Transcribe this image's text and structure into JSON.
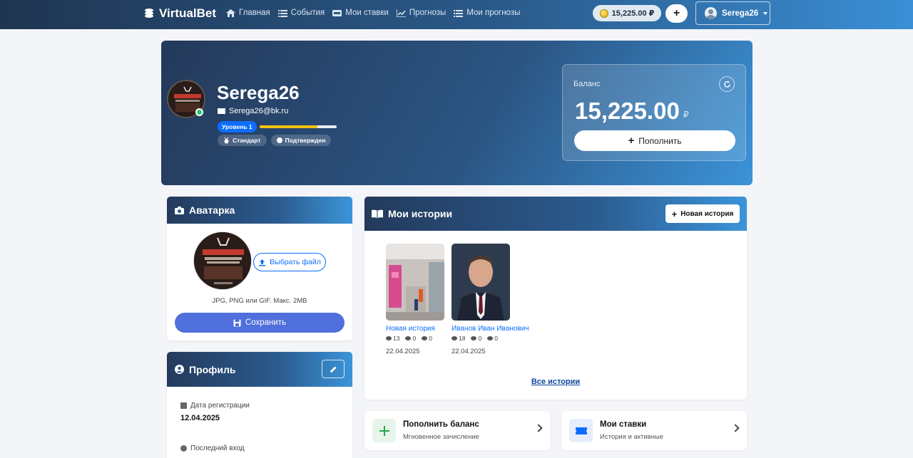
{
  "navbar": {
    "brand": "VirtualBet",
    "links": [
      {
        "label": "Главная",
        "icon": "home-icon"
      },
      {
        "label": "События",
        "icon": "list-icon"
      },
      {
        "label": "Мои ставки",
        "icon": "ticket-icon"
      },
      {
        "label": "Прогнозы",
        "icon": "chart-icon"
      },
      {
        "label": "Мои прогнозы",
        "icon": "list-icon"
      }
    ],
    "balance": "15,225.00 ₽",
    "plus": "+",
    "username": "Serega26"
  },
  "hero": {
    "name": "Serega26",
    "email": "Serega26@bk.ru",
    "level_label": "Уровень 1",
    "level_progress_percent": 75,
    "tags": [
      "Стандарт",
      "Подтвержден"
    ]
  },
  "balance_card": {
    "label": "Баланс",
    "amount": "15,225.00",
    "currency": "₽",
    "topup_label": "Пополнить"
  },
  "avatar_card": {
    "title": "Аватарка",
    "choose_label": "Выбрать файл",
    "hint": "JPG, PNG или GIF. Макс. 2MB",
    "save_label": "Сохранить"
  },
  "profile_card": {
    "title": "Профиль",
    "fields": [
      {
        "label": "Дата регистрации",
        "value": "12.04.2025"
      },
      {
        "label": "Последний вход",
        "value": ""
      }
    ]
  },
  "stories_card": {
    "title": "Мои истории",
    "new_story_label": "Новая история",
    "stories": [
      {
        "title": "Новая история",
        "views": "13",
        "likes": "0",
        "comments": "0",
        "date": "22.04.2025"
      },
      {
        "title": "Иванов Иван Иванович",
        "views": "18",
        "likes": "0",
        "comments": "0",
        "date": "22.04.2025"
      }
    ],
    "all_label": "Все истории"
  },
  "actions": [
    {
      "title": "Пополнить баланс",
      "subtitle": "Мгновенное зачисление",
      "icon": "plus-icon",
      "color": "#28a745"
    },
    {
      "title": "Мои ставки",
      "subtitle": "История и активные",
      "icon": "ticket-icon",
      "color": "#0d6efd"
    }
  ]
}
